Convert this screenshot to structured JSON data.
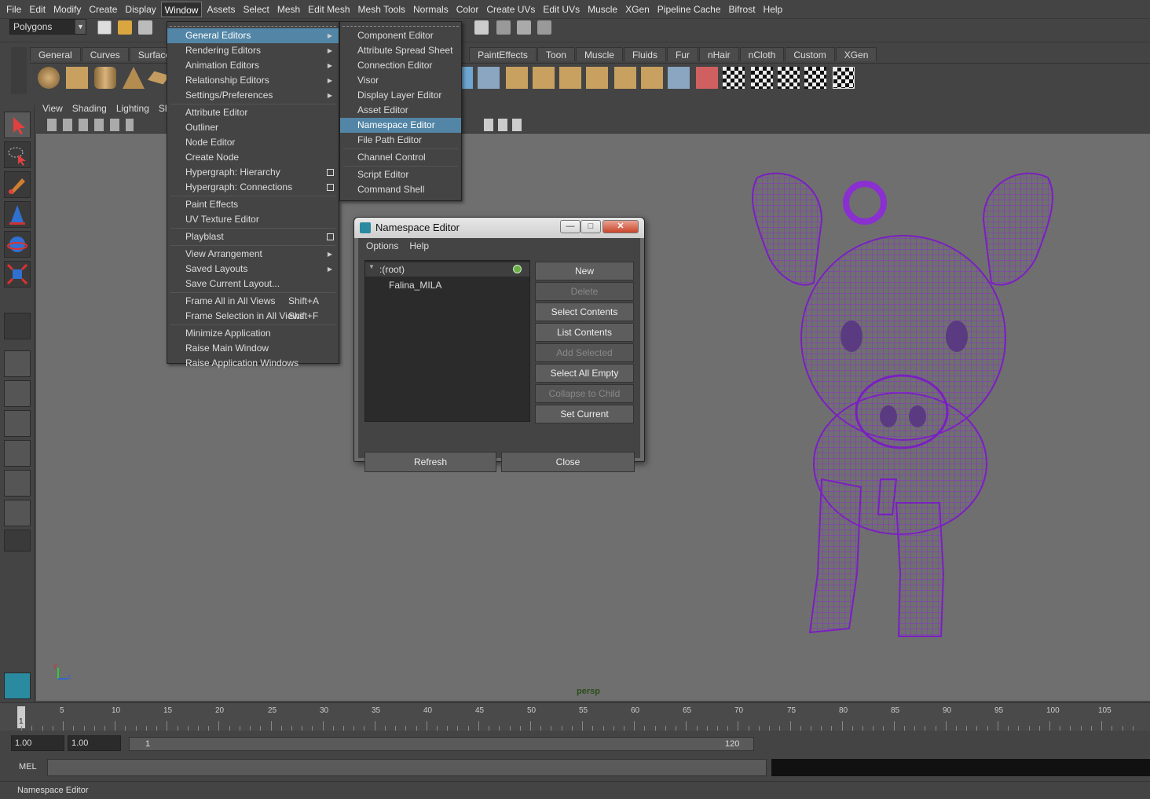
{
  "menubar": {
    "items": [
      "File",
      "Edit",
      "Modify",
      "Create",
      "Display",
      "Window",
      "Assets",
      "Select",
      "Mesh",
      "Edit Mesh",
      "Mesh Tools",
      "Normals",
      "Color",
      "Create UVs",
      "Edit UVs",
      "Muscle",
      "XGen",
      "Pipeline Cache",
      "Bifrost",
      "Help"
    ],
    "active": "Window"
  },
  "statusline": {
    "mode": "Polygons"
  },
  "shelf": {
    "tabs": [
      "General",
      "Curves",
      "Surfaces",
      "PaintEffects",
      "Toon",
      "Muscle",
      "Fluids",
      "Fur",
      "nHair",
      "nCloth",
      "Custom",
      "XGen"
    ]
  },
  "panel": {
    "menus": [
      "View",
      "Shading",
      "Lighting",
      "Sho"
    ],
    "camera_label": "persp",
    "axis_labels": {
      "y": "y",
      "z": "z"
    }
  },
  "window_menu": {
    "items": [
      {
        "label": "General Editors",
        "submenu": true,
        "highlight": true
      },
      {
        "label": "Rendering Editors",
        "submenu": true
      },
      {
        "label": "Animation Editors",
        "submenu": true
      },
      {
        "label": "Relationship Editors",
        "submenu": true
      },
      {
        "label": "Settings/Preferences",
        "submenu": true
      },
      {
        "sep": true
      },
      {
        "label": "Attribute Editor"
      },
      {
        "label": "Outliner"
      },
      {
        "label": "Node Editor"
      },
      {
        "label": "Create Node"
      },
      {
        "label": "Hypergraph: Hierarchy",
        "box": true
      },
      {
        "label": "Hypergraph: Connections",
        "box": true
      },
      {
        "sep": true
      },
      {
        "label": "Paint Effects"
      },
      {
        "label": "UV Texture Editor"
      },
      {
        "sep": true
      },
      {
        "label": "Playblast",
        "box": true
      },
      {
        "sep": true
      },
      {
        "label": "View Arrangement",
        "submenu": true
      },
      {
        "label": "Saved Layouts",
        "submenu": true
      },
      {
        "label": "Save Current Layout..."
      },
      {
        "sep": true
      },
      {
        "label": "Frame All in All Views",
        "shortcut": "Shift+A"
      },
      {
        "label": "Frame Selection in All Views",
        "shortcut": "Shift+F"
      },
      {
        "sep": true
      },
      {
        "label": "Minimize Application"
      },
      {
        "label": "Raise Main Window"
      },
      {
        "label": "Raise Application Windows"
      }
    ]
  },
  "general_editors_menu": {
    "items": [
      {
        "label": "Component Editor"
      },
      {
        "label": "Attribute Spread Sheet"
      },
      {
        "label": "Connection Editor"
      },
      {
        "label": "Visor"
      },
      {
        "label": "Display Layer Editor"
      },
      {
        "label": "Asset Editor"
      },
      {
        "label": "Namespace Editor",
        "highlight": true
      },
      {
        "label": "File Path Editor"
      },
      {
        "sep": true
      },
      {
        "label": "Channel Control"
      },
      {
        "sep": true
      },
      {
        "label": "Script Editor"
      },
      {
        "label": "Command Shell"
      }
    ]
  },
  "namespace_editor": {
    "title": "Namespace Editor",
    "menus": [
      "Options",
      "Help"
    ],
    "tree": {
      "root": ":(root)",
      "children": [
        "Falina_MILA"
      ]
    },
    "buttons": [
      {
        "label": "New",
        "enabled": true
      },
      {
        "label": "Delete",
        "enabled": false
      },
      {
        "label": "Select Contents",
        "enabled": true
      },
      {
        "label": "List Contents",
        "enabled": true
      },
      {
        "label": "Add Selected",
        "enabled": false
      },
      {
        "label": "Select All Empty",
        "enabled": true
      },
      {
        "label": "Collapse to Child",
        "enabled": false
      },
      {
        "label": "Set Current",
        "enabled": true
      }
    ],
    "refresh_label": "Refresh",
    "close_label": "Close",
    "window_buttons": {
      "minimize": "—",
      "maximize": "□",
      "close": "✕"
    }
  },
  "timeline": {
    "ticks": [
      5,
      10,
      15,
      20,
      25,
      30,
      35,
      40,
      45,
      50,
      55,
      60,
      65,
      70,
      75,
      80,
      85,
      90,
      95,
      100,
      105
    ],
    "current_frame": "1"
  },
  "range": {
    "start_time": "1.00",
    "playback_start": "1.00",
    "range_start": "1",
    "range_end": "120"
  },
  "command_line": {
    "language": "MEL"
  },
  "help_line": {
    "text": "Namespace Editor"
  },
  "colors": {
    "wireframe": "#8a2fd0",
    "highlight": "#5285a6"
  }
}
